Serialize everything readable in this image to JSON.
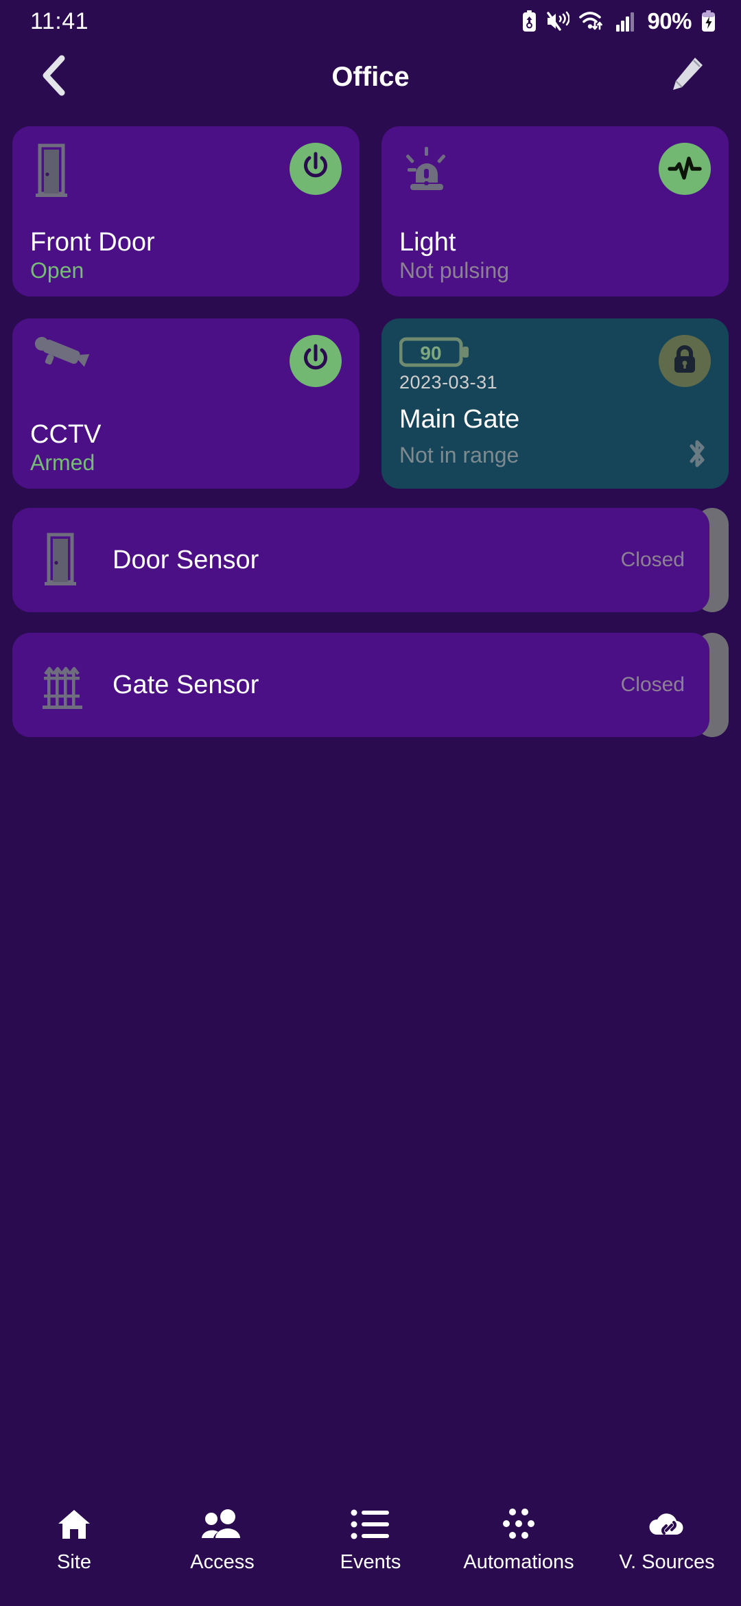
{
  "status_bar": {
    "time": "11:41",
    "battery_percent": "90%",
    "icons": [
      "battery-saver-icon",
      "mute-vibrate-icon",
      "wifi-icon",
      "cellular-signal-icon",
      "charging-battery-icon"
    ]
  },
  "header": {
    "back_label": "back-chevron",
    "title": "Office",
    "edit_label": "edit-pencil"
  },
  "cards": [
    {
      "id": "front-door",
      "icon": "door-icon",
      "title": "Front Door",
      "status": "Open",
      "status_kind": "green",
      "badge": "power-icon",
      "badge_color": "#72b872",
      "theme": "purple"
    },
    {
      "id": "light",
      "icon": "siren-icon",
      "title": "Light",
      "status": "Not pulsing",
      "status_kind": "muted",
      "badge": "pulse-icon",
      "badge_color": "#72b872",
      "theme": "purple"
    },
    {
      "id": "cctv",
      "icon": "cctv-camera-icon",
      "title": "CCTV",
      "status": "Armed",
      "status_kind": "green",
      "badge": "power-icon",
      "badge_color": "#72b872",
      "theme": "purple"
    },
    {
      "id": "main-gate",
      "icon": "battery-level-icon",
      "battery_level": "90",
      "date": "2023-03-31",
      "title": "Main Gate",
      "status": "Not in range",
      "status_kind": "muted",
      "badge": "lock-icon",
      "badge_color": "#5f6b4a",
      "trailing_icon": "bluetooth-icon",
      "theme": "teal"
    }
  ],
  "sensor_rows": [
    {
      "id": "door-sensor",
      "icon": "door-icon",
      "label": "Door Sensor",
      "status": "Closed"
    },
    {
      "id": "gate-sensor",
      "icon": "gate-icon",
      "label": "Gate Sensor",
      "status": "Closed"
    }
  ],
  "bottom_nav": [
    {
      "id": "site",
      "icon": "home-icon",
      "label": "Site"
    },
    {
      "id": "access",
      "icon": "people-icon",
      "label": "Access"
    },
    {
      "id": "events",
      "icon": "list-icon",
      "label": "Events"
    },
    {
      "id": "automations",
      "icon": "nodes-icon",
      "label": "Automations"
    },
    {
      "id": "v-sources",
      "icon": "cloud-link-icon",
      "label": "V. Sources"
    }
  ],
  "colors": {
    "background": "#2b0b4f",
    "card": "#4b1086",
    "card_teal": "#164559",
    "accent_green": "#72b872",
    "muted_text": "#8d8194"
  }
}
